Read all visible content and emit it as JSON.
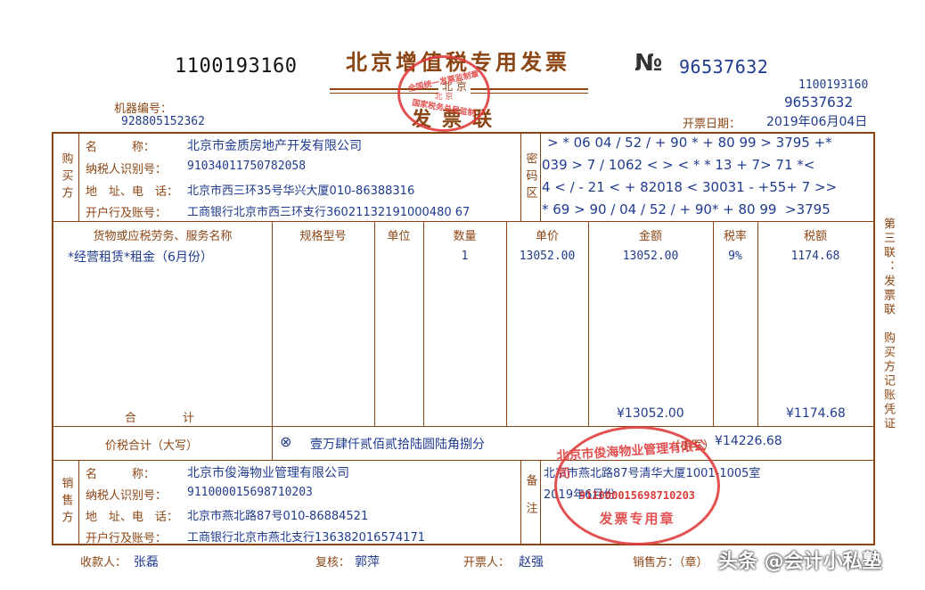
{
  "header": {
    "invoice_code_left": "1100193160",
    "title": "北京增值税专用发票",
    "title_city": "北 京",
    "subtitle": "发票联",
    "number_symbol": "№",
    "invoice_number": "96537632",
    "invoice_code_right": "1100193160",
    "invoice_number_right": "96537632",
    "machine_label": "机器编号：",
    "machine_number": "928805152362",
    "date_label": "开票日期：",
    "date_value": "2019年06月04日"
  },
  "tax_stamp": {
    "top": "全国统一发票监制章",
    "middle": "北 京",
    "bottom": "国家税务总局监制"
  },
  "buyer": {
    "section_label": "购买方",
    "name_label": "名　　　称：",
    "name": "北京市金质房地产开发有限公司",
    "tax_id_label": "纳税人识别号：",
    "tax_id": "91034011750782058",
    "address_label": "地　址、电　话：",
    "address": "北京市西三环35号华兴大厦010-86388316",
    "bank_label": "开户行及账号：",
    "bank": "工商银行北京市西三环支行36021132191000480 67"
  },
  "password_area": {
    "label": "密码区",
    "lines": [
      "> * 06 04 / 52 / + 90 * + 80 99 > 3795 +*",
      "039 > 7 / 1062 < > < * * 13 + 7> 71 *<",
      "4 < / - 21 < + 82018 < 30031 - +55+ 7 >>",
      "* 69 > 90 / 04 / 52 / + 90* + 80 99  >3795"
    ]
  },
  "items": {
    "headers": [
      "货物或应税劳务、服务名称",
      "规格型号",
      "单位",
      "数量",
      "单价",
      "金额",
      "税率",
      "税额"
    ],
    "rows": [
      {
        "name": "*经营租赁*租金（6月份）",
        "spec": "",
        "unit": "",
        "qty": "1",
        "price": "13052.00",
        "amount": "13052.00",
        "rate": "9%",
        "tax": "1174.68"
      }
    ],
    "total_label": "合　　　　计",
    "total_amount": "¥13052.00",
    "total_tax": "¥1174.68"
  },
  "price_tax_total": {
    "label": "价税合计（大写）",
    "symbol": "⊗",
    "in_words": "壹万肆仟贰佰贰拾陆圆陆角捌分",
    "small_label": "（小写）",
    "small_value": "¥14226.68"
  },
  "seller": {
    "section_label": "销售方",
    "name_label": "名　　　称：",
    "name": "北京市俊海物业管理有限公司",
    "tax_id_label": "纳税人识别号：",
    "tax_id": "911000015698710203",
    "address_label": "地　址、电　话：",
    "address": "北京市燕北路87号010-86884521",
    "bank_label": "开户行及账号：",
    "bank": "工商银行北京市燕北支行136382016574171"
  },
  "remarks": {
    "label": "备注",
    "line1": "北京市燕北路87号清华大厦1001-1005室",
    "line2": "2019年6月份"
  },
  "seller_stamp": {
    "top": "北京市俊海物业管理有限公司",
    "middle": "911000015698710203",
    "bottom": "发票专用章"
  },
  "side_note": "第三联：发票联　购买方记账凭证",
  "footer": {
    "payee_label": "收款人：",
    "payee": "张磊",
    "reviewer_label": "复核：",
    "reviewer": "郭萍",
    "drawer_label": "开票人：",
    "drawer": "赵强",
    "seller_label": "销售方：（章）"
  },
  "watermark": "头条 @会计小私塾"
}
